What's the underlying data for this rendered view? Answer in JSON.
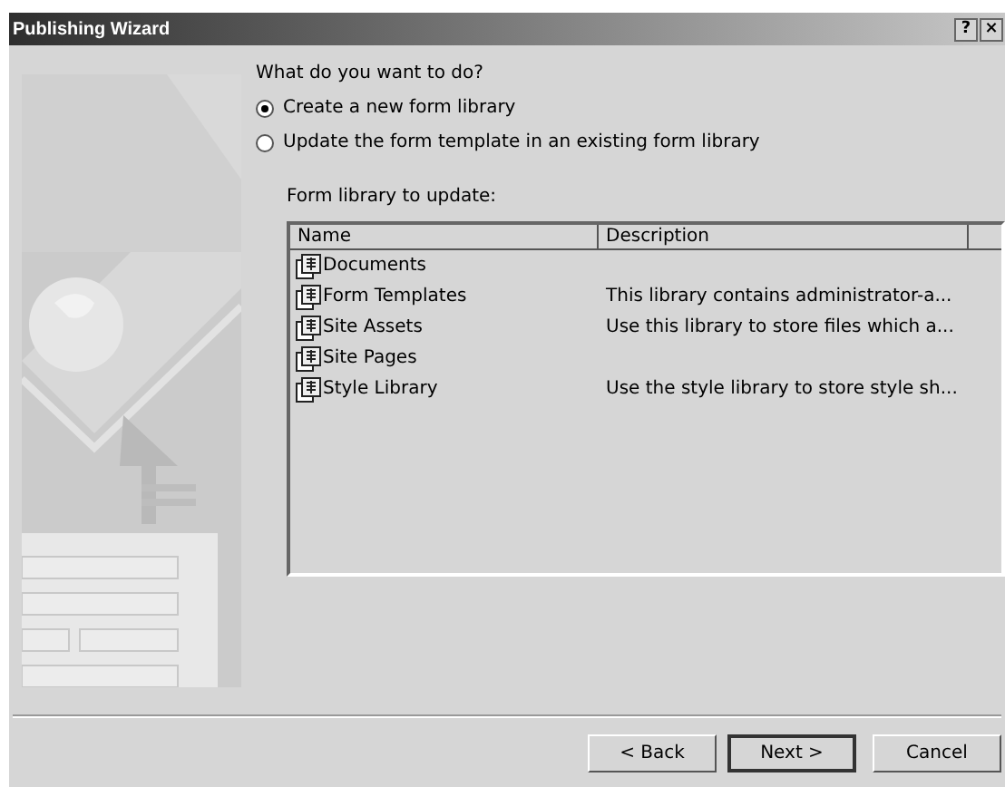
{
  "window": {
    "title": "Publishing Wizard",
    "title_buttons": [
      "?",
      "×"
    ]
  },
  "question": "What do you want to do?",
  "options": [
    {
      "label": "Create a new form library",
      "selected": true
    },
    {
      "label": "Update the form template in an existing form library",
      "selected": false
    }
  ],
  "list_label": "Form library to update:",
  "table": {
    "columns": [
      "Name",
      "Description"
    ],
    "rows": [
      {
        "name": "Documents",
        "description": ""
      },
      {
        "name": "Form Templates",
        "description": "This library contains administrator-a..."
      },
      {
        "name": "Site Assets",
        "description": "Use this library to store files which a..."
      },
      {
        "name": "Site Pages",
        "description": ""
      },
      {
        "name": "Style Library",
        "description": "Use the style library to store style sh..."
      }
    ]
  },
  "buttons": [
    {
      "label": "< Back",
      "default": false
    },
    {
      "label": "Next >",
      "default": true
    },
    {
      "label": "Cancel",
      "default": false
    }
  ]
}
